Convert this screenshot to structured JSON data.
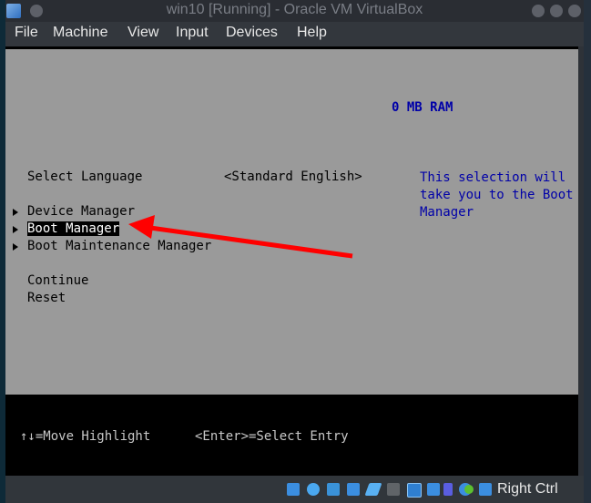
{
  "window": {
    "title": "win10 [Running] - Oracle VM VirtualBox"
  },
  "menubar": {
    "items": [
      "File",
      "Machine",
      "View",
      "Input",
      "Devices",
      "Help"
    ]
  },
  "bios": {
    "ram": "0 MB RAM",
    "language_label": "Select Language",
    "language_value": "<Standard English>",
    "menu_items": [
      {
        "label": "Device Manager",
        "has_submenu": true,
        "selected": false
      },
      {
        "label": "Boot Manager",
        "has_submenu": true,
        "selected": true
      },
      {
        "label": "Boot Maintenance Manager",
        "has_submenu": true,
        "selected": false
      }
    ],
    "actions": [
      "Continue",
      "Reset"
    ],
    "help_lines": [
      "This selection will",
      "take you to the Boot",
      "Manager"
    ],
    "footer": {
      "move_hint": "↑↓=Move Highlight",
      "select_hint": "<Enter>=Select Entry"
    }
  },
  "annotation": {
    "type": "red-arrow",
    "points_to": "Boot Manager",
    "color": "#ff0000"
  },
  "statusbar": {
    "icons": [
      "hard-disk-icon",
      "optical-disk-icon",
      "audio-icon",
      "network-icon",
      "usb-icon",
      "shared-folders-icon",
      "display-icon",
      "video-capture-icon",
      "vrde-icon",
      "guest-additions-icon",
      "mouse-integration-icon",
      "keyboard-capture-icon"
    ],
    "host_key": "Right Ctrl"
  }
}
